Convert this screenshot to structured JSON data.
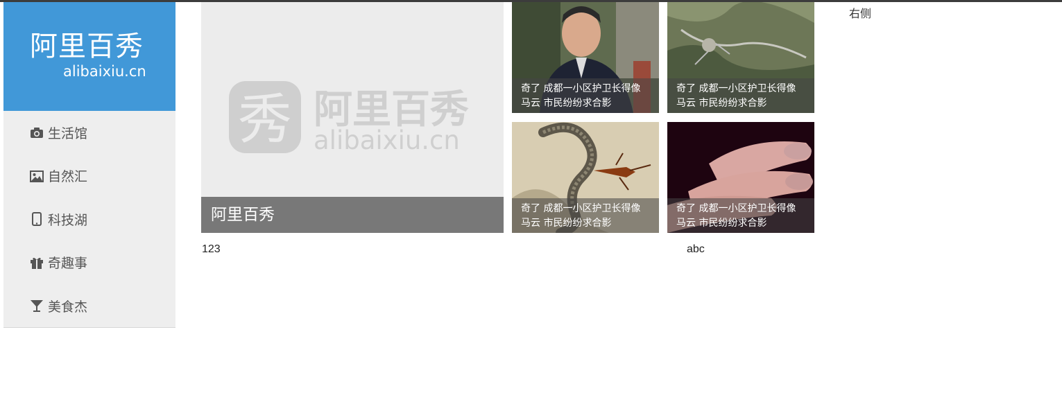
{
  "logo": {
    "cn": "阿里百秀",
    "en": "alibaixiu.cn"
  },
  "nav": [
    {
      "label": "生活馆",
      "icon": "camera-icon"
    },
    {
      "label": "自然汇",
      "icon": "picture-icon"
    },
    {
      "label": "科技湖",
      "icon": "phone-icon"
    },
    {
      "label": "奇趣事",
      "icon": "gift-icon"
    },
    {
      "label": "美食杰",
      "icon": "cocktail-glass-icon"
    }
  ],
  "featured": {
    "caption": "阿里百秀",
    "watermark_cn": "阿里百秀",
    "watermark_en": "alibaixiu.cn",
    "watermark_char": "秀"
  },
  "tiles": [
    {
      "line1": "奇了 成都一小区护卫长得像",
      "line2": "马云 市民纷纷求合影",
      "image": "man-in-guard-uniform"
    },
    {
      "line1": "奇了 成都一小区护卫长得像",
      "line2": "马云 市民纷纷求合影",
      "image": "aerial-terrain-map"
    },
    {
      "line1": "奇了 成都一小区护卫长得像",
      "line2": "马云 市民纷纷求合影",
      "image": "snake-and-insect"
    },
    {
      "line1": "奇了 成都一小区护卫长得像",
      "line2": "马云 市民纷纷求合影",
      "image": "fingers-close-up"
    }
  ],
  "labels": {
    "left": "123",
    "mid": "abc",
    "right": "右侧"
  },
  "colors": {
    "brand": "#4198d8",
    "sidebar_bg": "#eeeeee",
    "caption_bg": "#6e6e6e"
  }
}
